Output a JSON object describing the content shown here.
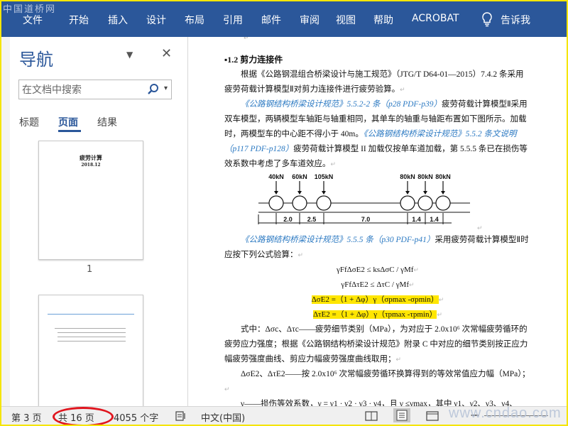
{
  "watermark_top": "中国道桥网",
  "watermark_bottom": "www.cndao.com",
  "ribbon": {
    "tabs": [
      "文件",
      "开始",
      "插入",
      "设计",
      "布局",
      "引用",
      "邮件",
      "审阅",
      "视图",
      "帮助",
      "ACROBAT"
    ],
    "tell_me": "告诉我"
  },
  "nav": {
    "title": "导航",
    "menu_icon": "▼",
    "close_icon": "✕",
    "search_placeholder": "在文档中搜索",
    "tabs": [
      "标题",
      "页面",
      "结果"
    ],
    "active_tab": "页面",
    "page1": {
      "title": "疲劳计算",
      "date": "2018.12",
      "number": "1"
    }
  },
  "document": {
    "heading": "1.2  剪力连接件",
    "para1": "根据《公路钢混组合桥梁设计与施工规范》（JTG/T D64-01—2015）7.4.2 条采用疲劳荷载计算模型Ⅱ对剪力连接件进行疲劳验算。",
    "para2_link1": "《公路钢结构桥梁设计规范》5.5.2-2 条（p28 PDF-p39）",
    "para2_text1": "疲劳荷载计算模型Ⅱ采用双车模型，两辆模型车轴距与轴重相同，其单车的轴重与轴距布置如下图所示。加载时，两模型车的中心距不得小于 40m。",
    "para2_link2": "《公路钢结构桥梁设计规范》5.5.2 条文说明（p117 PDF-p128）",
    "para2_text2": "疲劳荷载计算模型 II 加载仅按单车道加载，第 5.5.5 条已在损伤等效系数中考虑了多车道效应。",
    "figure": {
      "loads": [
        "40kN",
        "60kN",
        "105kN",
        "80kN",
        "80kN",
        "80kN"
      ],
      "dims": [
        "2.0",
        "2.5",
        "7.0",
        "1.4",
        "1.4"
      ]
    },
    "para3_link": "《公路钢结构桥梁设计规范》5.5.5 条（p30 PDF-p41）",
    "para3_text": "采用疲劳荷载计算模型Ⅱ时应按下列公式验算：",
    "formula1": "γFfΔσE2 ≤ ksΔσC / γMf",
    "formula2": "γFfΔτE2 ≤ ΔτC / γMf",
    "formula3": "ΔσE2 =（1 + Δφ）γ（σpmax -σpmin）",
    "formula4": "ΔτE2 =（1 + Δφ）γ（τpmax -τpmin）",
    "para4": "式中：Δσc、Δτc——疲劳细节类别（MPa），为对应于 2.0x10⁶ 次常幅疲劳循环的疲劳应力强度；根据《公路钢结构桥梁设计规范》附录 C 中对应的细节类别按正应力幅疲劳强度曲线、剪应力幅疲劳强度曲线取用；",
    "para5": "ΔσE2、ΔτE2——按 2.0x10⁶ 次常幅疲劳循环换算得到的等效常值应力幅（MPa）；",
    "para6": "γ——损伤等效系数，γ = γ1 · γ2 · γ3 · γ4，且 γ ≤γmax，其中 γ1、γ2、γ3、γ4、γmax"
  },
  "status": {
    "page": "第 3 页",
    "total": "共 16 页",
    "words": "4055 个字",
    "language": "中文(中国)"
  }
}
